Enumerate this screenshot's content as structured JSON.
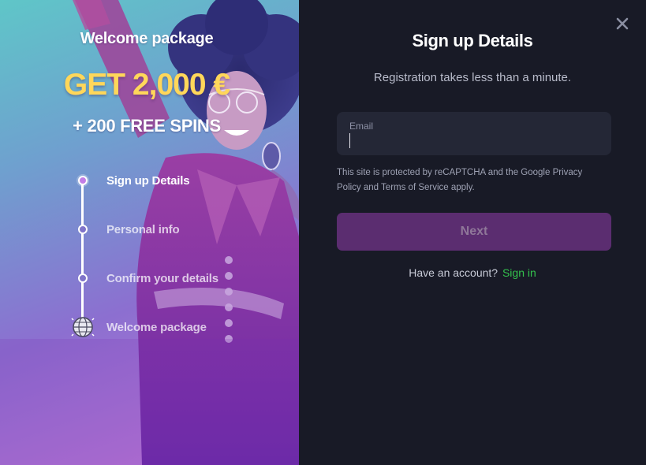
{
  "promo": {
    "title": "Welcome package",
    "amount": "GET 2,000 €",
    "spins": "+ 200 FREE SPINS",
    "steps": [
      {
        "label": "Sign up Details",
        "state": "active"
      },
      {
        "label": "Personal info",
        "state": "pending"
      },
      {
        "label": "Confirm your details",
        "state": "pending"
      },
      {
        "label": "Welcome package",
        "state": "final",
        "icon": "globe-icon"
      }
    ]
  },
  "form": {
    "title": "Sign up Details",
    "subtitle": "Registration takes less than a minute.",
    "email_label": "Email",
    "email_value": "",
    "recaptcha_text": "This site is protected by reCAPTCHA and the Google Privacy Policy and Terms of Service apply.",
    "next_label": "Next",
    "have_account": "Have an account?",
    "signin_label": "Sign in"
  },
  "icons": {
    "close": "close-icon"
  },
  "colors": {
    "panel_bg": "#181a26",
    "input_bg": "#242736",
    "accent_gold": "#ffd75a",
    "next_button": "#5b2d70",
    "link_green": "#33c24d"
  }
}
